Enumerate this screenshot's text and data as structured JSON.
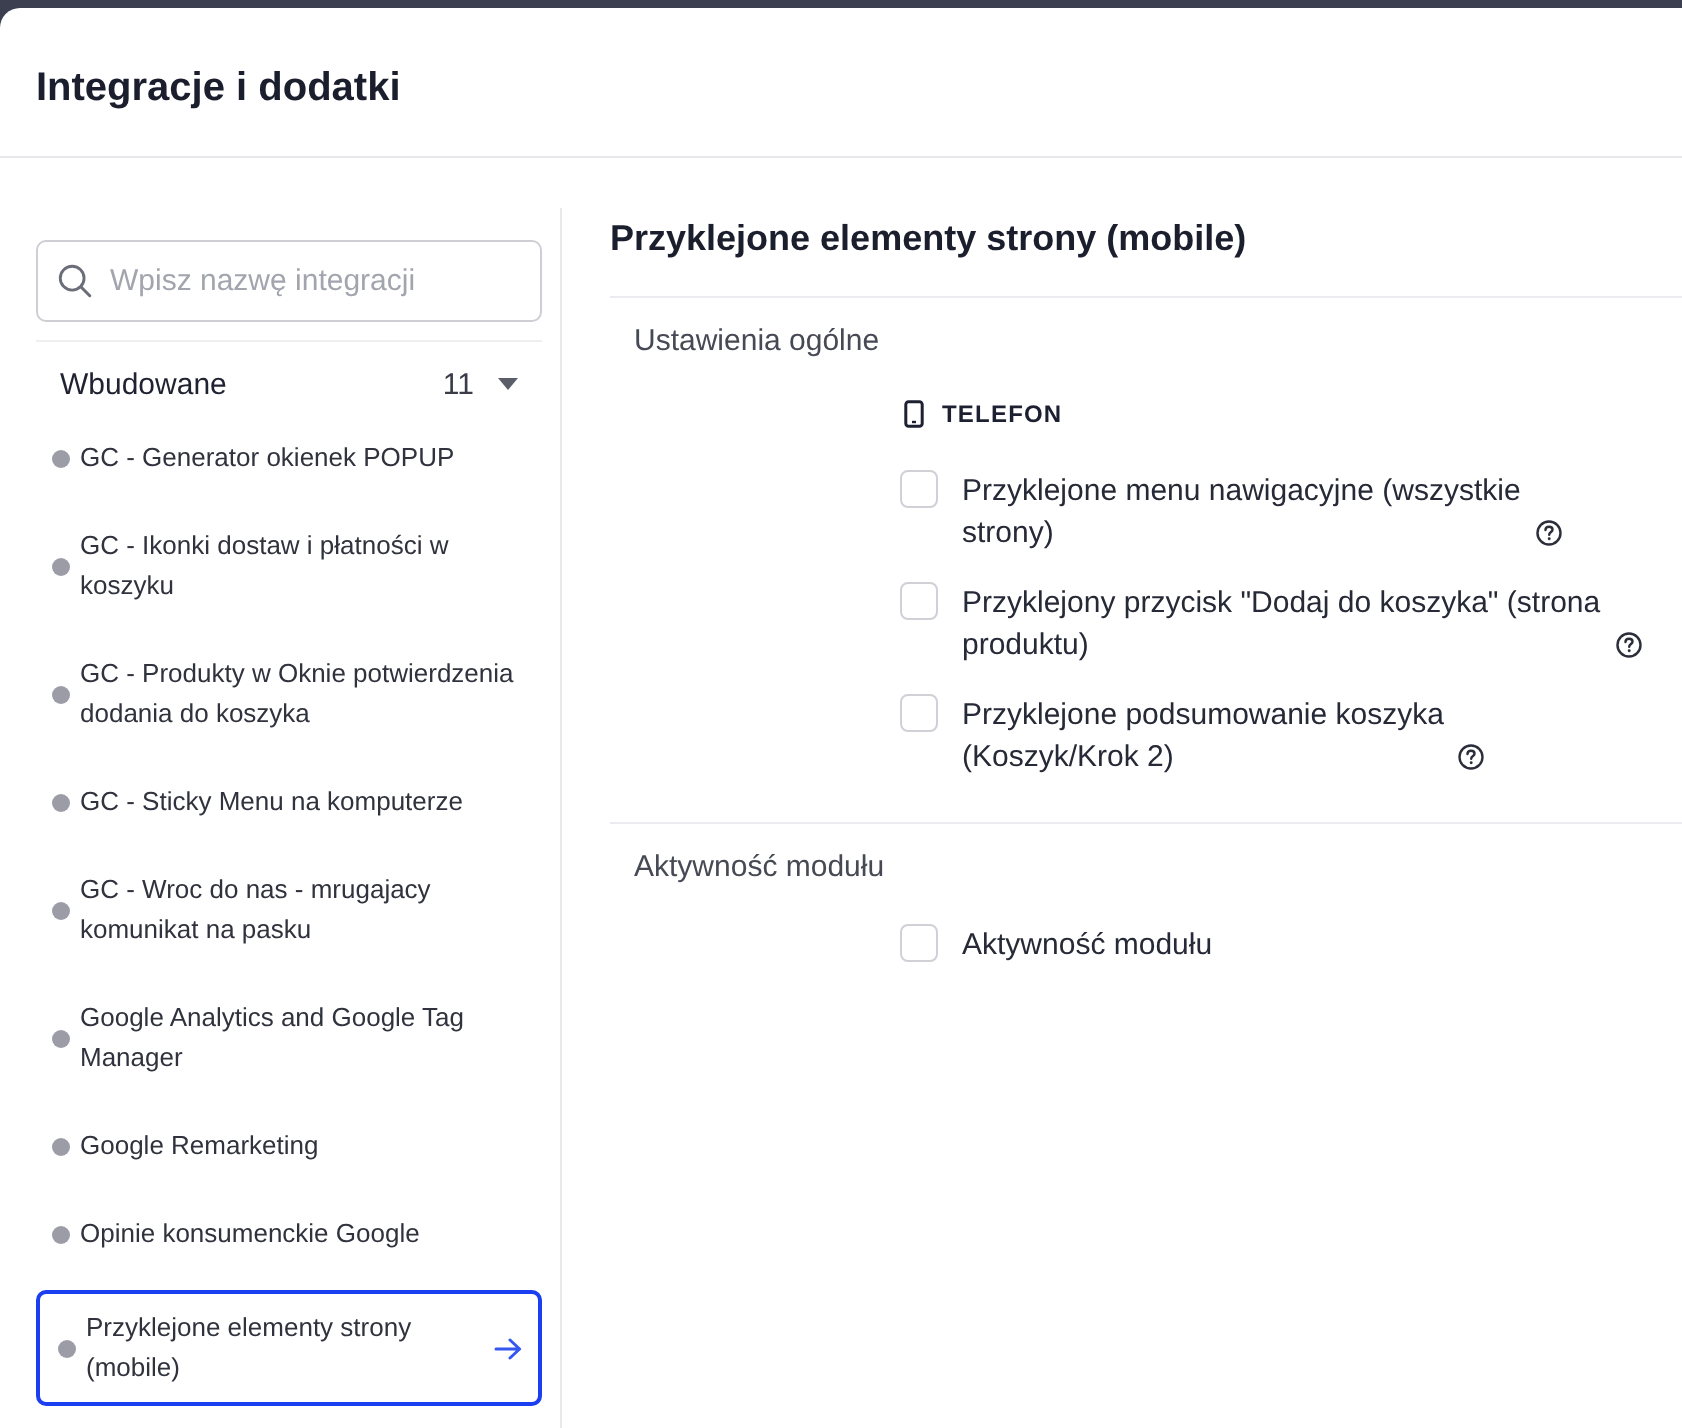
{
  "header": {
    "title": "Integracje i dodatki"
  },
  "sidebar": {
    "search": {
      "placeholder": "Wpisz nazwę integracji"
    },
    "group": {
      "title": "Wbudowane",
      "count": "11",
      "expanded": true
    },
    "items": [
      {
        "name": "GC - Generator okienek POPUP",
        "selected": false
      },
      {
        "name": "GC - Ikonki dostaw i płatności w koszyku",
        "selected": false
      },
      {
        "name": "GC - Produkty w Oknie potwierdzenia dodania do koszyka",
        "selected": false
      },
      {
        "name": "GC - Sticky Menu na komputerze",
        "selected": false
      },
      {
        "name": "GC - Wroc do nas - mrugajacy komunikat na pasku",
        "selected": false
      },
      {
        "name": "Google Analytics and Google Tag Manager",
        "selected": false
      },
      {
        "name": "Google Remarketing",
        "selected": false
      },
      {
        "name": "Opinie konsumenckie Google",
        "selected": false
      },
      {
        "name": "Przyklejone elementy strony (mobile)",
        "selected": true
      }
    ]
  },
  "panel": {
    "title": "Przyklejone elementy strony (mobile)",
    "sections": [
      {
        "title": "Ustawienia ogólne",
        "device": "TELEFON",
        "options": [
          {
            "label": "Przyklejone menu nawigacyjne (wszystkie strony)",
            "help": true,
            "checked": false
          },
          {
            "label": "Przyklejony przycisk \"Dodaj do koszyka\" (strona produktu)",
            "help": true,
            "checked": false
          },
          {
            "label": "Przyklejone podsumowanie koszyka (Koszyk/Krok 2)",
            "help": true,
            "checked": false
          }
        ]
      },
      {
        "title": "Aktywność modułu",
        "options": [
          {
            "label": "Aktywność modułu",
            "help": false,
            "checked": false
          }
        ]
      }
    ]
  }
}
